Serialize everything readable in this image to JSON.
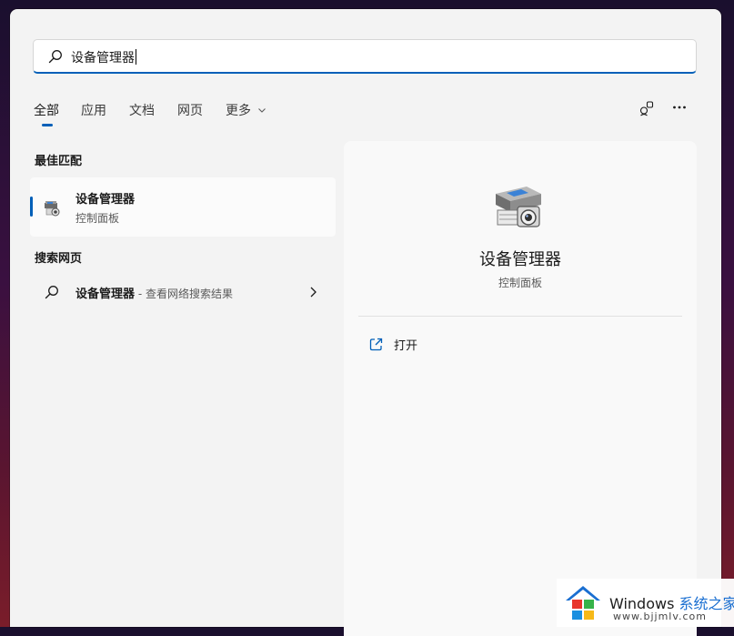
{
  "search": {
    "query": "设备管理器"
  },
  "tabs": [
    {
      "label": "全部",
      "active": true
    },
    {
      "label": "应用"
    },
    {
      "label": "文档"
    },
    {
      "label": "网页"
    },
    {
      "label": "更多"
    }
  ],
  "best_match": {
    "heading": "最佳匹配",
    "title": "设备管理器",
    "subtitle": "控制面板"
  },
  "web_search": {
    "heading": "搜索网页",
    "query": "设备管理器",
    "suffix": " - 查看网络搜索结果"
  },
  "detail": {
    "title": "设备管理器",
    "subtitle": "控制面板",
    "actions": [
      {
        "label": "打开",
        "icon": "open-external-icon"
      }
    ]
  },
  "watermark": {
    "brand": "Windows",
    "brand_cn": "系统之家",
    "url": "www.bjjmlv.com"
  },
  "colors": {
    "accent": "#005fb8",
    "panel_bg": "#f3f3f3"
  }
}
